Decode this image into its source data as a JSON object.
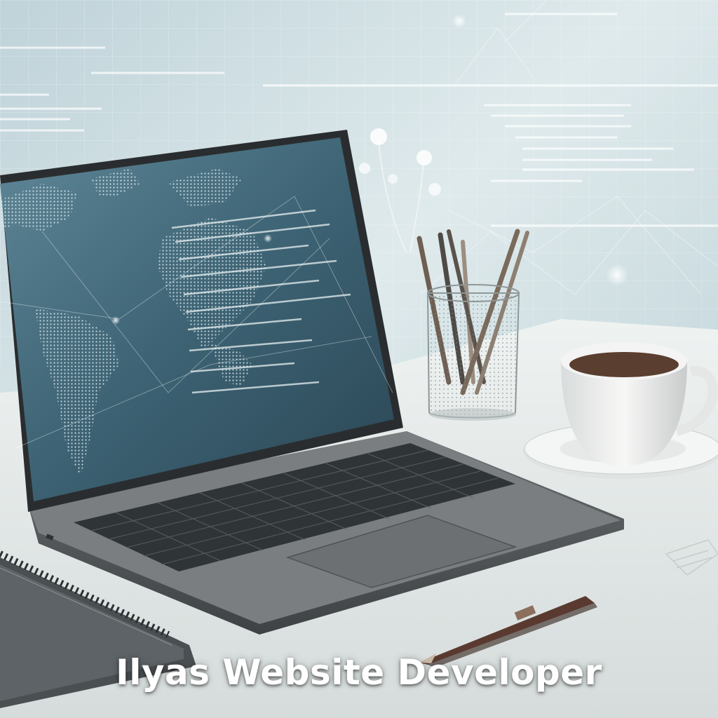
{
  "caption": {
    "text": "Ilyas Website Developer"
  },
  "colors": {
    "wall": "#cfdfe4",
    "desk": "#e9eeed",
    "screen": "#3c6273",
    "laptop_body": "#55595b",
    "caption_text": "#ffffff"
  },
  "objects": [
    "laptop",
    "world-map-screen",
    "pencil-cup",
    "coffee-cup",
    "notebook",
    "pen",
    "flowers",
    "holographic-code-wall"
  ]
}
